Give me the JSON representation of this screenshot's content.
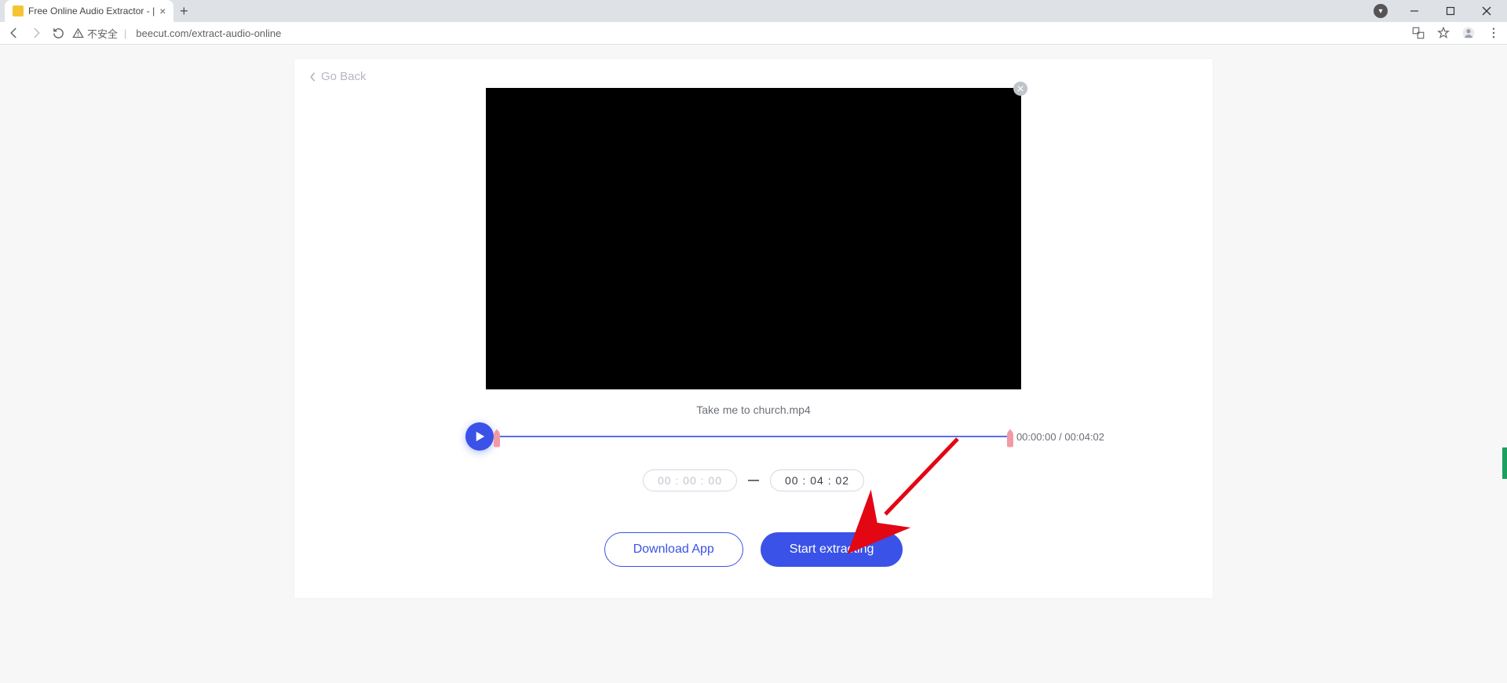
{
  "browser": {
    "tab_title": "Free Online Audio Extractor - |",
    "security_label": "不安全",
    "url_display": "beecut.com/extract-audio-online"
  },
  "page": {
    "go_back_label": "Go Back",
    "filename": "Take me to church.mp4",
    "time_counter": "00:00:00 / 00:04:02",
    "start_time_value": "00 : 00 : 00",
    "end_time_value": "00 : 04 : 02",
    "download_button_label": "Download App",
    "extract_button_label": "Start extracting"
  },
  "colors": {
    "accent": "#3a52e8",
    "handle": "#f29aa3",
    "annotation": "#e30613"
  }
}
